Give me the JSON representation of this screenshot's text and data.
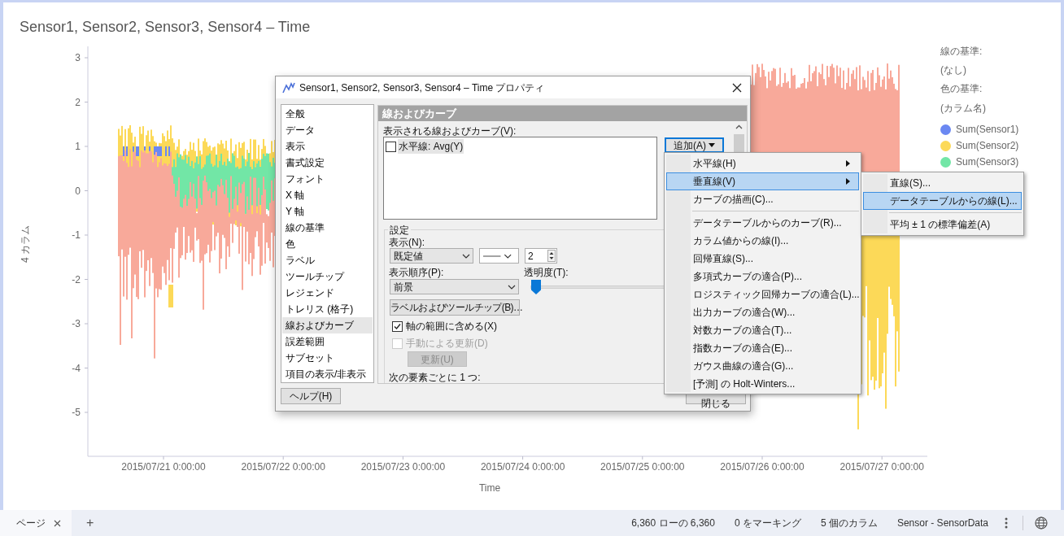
{
  "chart": {
    "title": "Sensor1, Sensor2, Sensor3, Sensor4 – Time",
    "y_title": "4 カラム",
    "x_title": "Time",
    "y_ticks": [
      "3",
      "2",
      "1",
      "0",
      "-1",
      "-2",
      "-3",
      "-4",
      "-5"
    ],
    "x_ticks": [
      "2015/07/21 0:00:00",
      "2015/07/22 0:00:00",
      "2015/07/23 0:00:00",
      "2015/07/24 0:00:00",
      "2015/07/25 0:00:00",
      "2015/07/26 0:00:00",
      "2015/07/27 0:00:00"
    ]
  },
  "legend": {
    "line_by_label": "線の基準:",
    "line_by_value": "(なし)",
    "color_by_label": "色の基準:",
    "color_by_value": "(カラム名)",
    "items": [
      {
        "label": "Sum(Sensor1)",
        "color": "#6b88f2"
      },
      {
        "label": "Sum(Sensor2)",
        "color": "#fcd958"
      },
      {
        "label": "Sum(Sensor3)",
        "color": "#72e6a6"
      }
    ]
  },
  "dialog": {
    "title": "Sensor1, Sensor2, Sensor3, Sensor4 – Time プロパティ",
    "nav": [
      {
        "label": "全般",
        "selected": false
      },
      {
        "label": "データ",
        "selected": false
      },
      {
        "label": "表示",
        "selected": false
      },
      {
        "label": "書式設定",
        "selected": false
      },
      {
        "label": "フォント",
        "selected": false
      },
      {
        "label": "X 軸",
        "selected": false
      },
      {
        "label": "Y 軸",
        "selected": false
      },
      {
        "label": "線の基準",
        "selected": false
      },
      {
        "label": "色",
        "selected": false
      },
      {
        "label": "ラベル",
        "selected": false
      },
      {
        "label": "ツールチップ",
        "selected": false
      },
      {
        "label": "レジェンド",
        "selected": false
      },
      {
        "label": "トレリス (格子)",
        "selected": false
      },
      {
        "label": "線およびカーブ",
        "selected": true
      },
      {
        "label": "誤差範囲",
        "selected": false
      },
      {
        "label": "サブセット",
        "selected": false
      },
      {
        "label": "項目の表示/非表示",
        "selected": false
      }
    ],
    "section_title": "線およびカーブ",
    "lines_label": "表示される線およびカーブ(V):",
    "lines": [
      {
        "label": "水平線: Avg(Y)",
        "checked": false,
        "selected": true
      }
    ],
    "add_button": "追加(A)",
    "settings": {
      "legend": "設定",
      "display_label": "表示(N):",
      "display_value": "既定値",
      "width_value": "2",
      "order_label": "表示順序(P):",
      "order_value": "前景",
      "transparency_label": "透明度(T):",
      "transparency_slider": {
        "level": 0
      },
      "label_button": "ラベルおよびツールチップ(B)…",
      "checks": [
        {
          "label": "軸の範囲に含める(X)",
          "checked": true,
          "disabled": false
        },
        {
          "label": "手動による更新(D)",
          "checked": false,
          "disabled": true
        }
      ],
      "update_button": "更新(U)",
      "update_disabled": true,
      "per_label": "次の要素ごとに 1 つ:"
    },
    "help_button": "ヘルプ(H)",
    "close_button": "閉じる"
  },
  "menu": {
    "items": [
      {
        "kind": "item",
        "label": "水平線(H)",
        "submenu": true,
        "selected": false
      },
      {
        "kind": "item",
        "label": "垂直線(V)",
        "submenu": true,
        "selected": true
      },
      {
        "kind": "item",
        "label": "カーブの描画(C)...",
        "submenu": false,
        "selected": false
      },
      {
        "kind": "separator"
      },
      {
        "kind": "item",
        "label": "データテーブルからのカーブ(R)...",
        "submenu": false,
        "selected": false
      },
      {
        "kind": "item",
        "label": "カラム値からの線(I)...",
        "submenu": false,
        "selected": false
      },
      {
        "kind": "item",
        "label": "回帰直線(S)...",
        "submenu": false,
        "selected": false
      },
      {
        "kind": "item",
        "label": "多項式カーブの適合(P)...",
        "submenu": false,
        "selected": false
      },
      {
        "kind": "item",
        "label": "ロジスティック回帰カーブの適合(L)...",
        "submenu": false,
        "selected": false
      },
      {
        "kind": "item",
        "label": "出力カーブの適合(W)...",
        "submenu": false,
        "selected": false
      },
      {
        "kind": "item",
        "label": "対数カーブの適合(T)...",
        "submenu": false,
        "selected": false
      },
      {
        "kind": "item",
        "label": "指数カーブの適合(E)...",
        "submenu": false,
        "selected": false
      },
      {
        "kind": "item",
        "label": "ガウス曲線の適合(G)...",
        "submenu": false,
        "selected": false
      },
      {
        "kind": "item",
        "label": "[予測] の Holt-Winters...",
        "submenu": false,
        "selected": false
      }
    ]
  },
  "submenu": {
    "items": [
      {
        "kind": "item",
        "label": "直線(S)...",
        "selected": false
      },
      {
        "kind": "item",
        "label": "データテーブルからの線(L)...",
        "selected": true
      },
      {
        "kind": "separator"
      },
      {
        "kind": "item",
        "label": "平均 ± 1 の標準偏差(A)",
        "selected": false
      }
    ]
  },
  "status_bar": {
    "page_tab": "ページ",
    "add_tab": "+",
    "rows": "6,360 ローの 6,360",
    "marked": "0 をマーキング",
    "columns": "5 個のカラム",
    "source": "Sensor - SensorData"
  }
}
